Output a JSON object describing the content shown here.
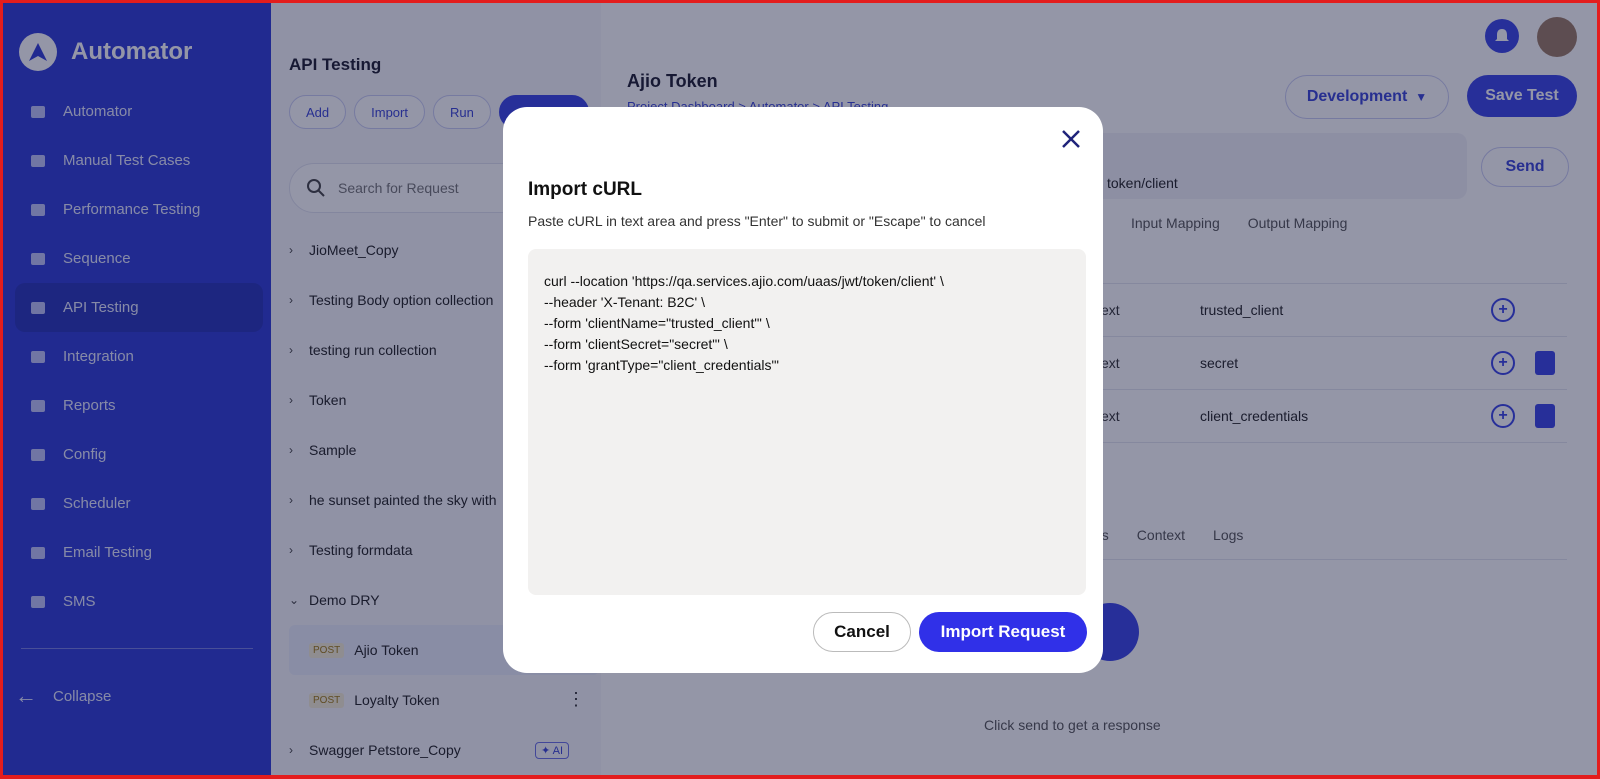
{
  "app": {
    "brand": "Automator"
  },
  "sidebar": {
    "items": [
      {
        "label": "Automator",
        "icon": "folder-icon"
      },
      {
        "label": "Manual Test Cases",
        "icon": "list-icon"
      },
      {
        "label": "Performance Testing",
        "icon": "robot-icon"
      },
      {
        "label": "Sequence",
        "icon": "sequence-icon"
      },
      {
        "label": "API Testing",
        "icon": "cloud-icon",
        "active": true
      },
      {
        "label": "Integration",
        "icon": "wrench-icon"
      },
      {
        "label": "Reports",
        "icon": "reports-icon"
      },
      {
        "label": "Config",
        "icon": "config-icon"
      },
      {
        "label": "Scheduler",
        "icon": "clock-icon"
      },
      {
        "label": "Email Testing",
        "icon": "mail-icon"
      },
      {
        "label": "SMS",
        "icon": "chat-icon"
      }
    ],
    "collapse_label": "Collapse"
  },
  "panel": {
    "title": "API Testing",
    "buttons": {
      "add": "Add",
      "import": "Import",
      "run": "Run"
    },
    "search_placeholder": "Search for Request",
    "collections": [
      "JioMeet_Copy",
      "Testing Body option collection",
      "testing run collection",
      "Token",
      "Sample",
      "he sunset painted the sky with",
      "Testing formdata"
    ],
    "expanded_collection": "Demo DRY",
    "requests": [
      {
        "method": "POST",
        "name": "Ajio Token"
      },
      {
        "method": "POST",
        "name": "Loyalty Token"
      }
    ],
    "last_collection": "Swagger Petstore_Copy",
    "ai_badge": "✦ AI"
  },
  "main": {
    "title": "Ajio Token",
    "breadcrumb": "Project Dashboard  >  Automator  >  API Testing",
    "environment": "Development",
    "save_label": "Save Test",
    "url_tail": "token/client",
    "send_label": "Send",
    "tabs": [
      "Input Mapping",
      "Output Mapping"
    ],
    "params": [
      {
        "type": "ext",
        "value": "trusted_client"
      },
      {
        "type": "ext",
        "value": "secret"
      },
      {
        "type": "ext",
        "value": "client_credentials"
      }
    ],
    "result_tabs": [
      "ults",
      "Context",
      "Logs"
    ],
    "response_hint": "Click send to get a response"
  },
  "modal": {
    "title": "Import cURL",
    "subtitle": "Paste cURL in text area and press \"Enter\" to submit or \"Escape\" to cancel",
    "curl": "curl --location 'https://qa.services.ajio.com/uaas/jwt/token/client' \\\n--header 'X-Tenant: B2C' \\\n--form 'clientName=\"trusted_client\"' \\\n--form 'clientSecret=\"secret\"' \\\n--form 'grantType=\"client_credentials\"'",
    "cancel_label": "Cancel",
    "import_label": "Import Request"
  },
  "colors": {
    "accent": "#3030e8",
    "sidebar": "#2f3bd6",
    "frame": "#e31d1d"
  }
}
